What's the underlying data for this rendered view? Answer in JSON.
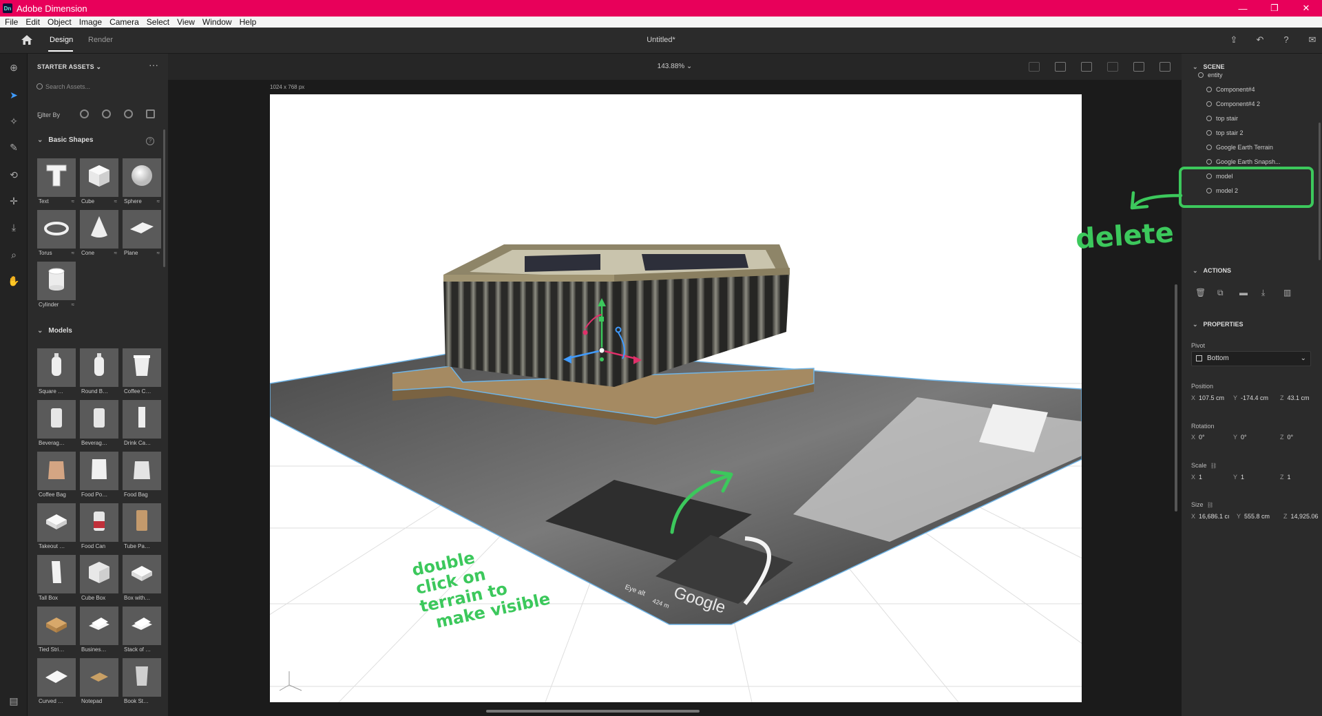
{
  "window": {
    "app_name": "Adobe Dimension",
    "logo": "Dn",
    "minimize": "—",
    "restore": "❐",
    "close": "✕"
  },
  "menu": [
    "File",
    "Edit",
    "Object",
    "Image",
    "Camera",
    "Select",
    "View",
    "Window",
    "Help"
  ],
  "topbar": {
    "tab_design": "Design",
    "tab_render": "Render",
    "doc_title": "Untitled*"
  },
  "canvas": {
    "zoom": "143.88% ⌄",
    "dimensions": "1024 x 768 px"
  },
  "assets": {
    "header": "STARTER ASSETS ⌄",
    "more": "···",
    "search_placeholder": "Search Assets...",
    "filter_label": "Filter By",
    "basic_shapes_title": "Basic Shapes",
    "basic_shapes": [
      {
        "label": "Text",
        "icon": "text-3d-icon"
      },
      {
        "label": "Cube",
        "icon": "cube-icon"
      },
      {
        "label": "Sphere",
        "icon": "sphere-icon"
      },
      {
        "label": "Torus",
        "icon": "torus-icon"
      },
      {
        "label": "Cone",
        "icon": "cone-icon"
      },
      {
        "label": "Plane",
        "icon": "plane-icon"
      },
      {
        "label": "Cylinder",
        "icon": "cylinder-icon"
      }
    ],
    "models_title": "Models",
    "models": [
      {
        "label": "Square Bo..."
      },
      {
        "label": "Round Bo..."
      },
      {
        "label": "Coffee Cup"
      },
      {
        "label": "Beverage ..."
      },
      {
        "label": "Beverage ..."
      },
      {
        "label": "Drink Cart..."
      },
      {
        "label": "Coffee Bag"
      },
      {
        "label": "Food Pouch"
      },
      {
        "label": "Food Bag"
      },
      {
        "label": "Takeout Box"
      },
      {
        "label": "Food Can"
      },
      {
        "label": "Tube Pack..."
      },
      {
        "label": "Tall Box"
      },
      {
        "label": "Cube Box"
      },
      {
        "label": "Box with O..."
      },
      {
        "label": "Tied String..."
      },
      {
        "label": "Business C..."
      },
      {
        "label": "Stack of Ca..."
      },
      {
        "label": "Curved Pla..."
      },
      {
        "label": "Notepad"
      },
      {
        "label": "Book Stan..."
      }
    ]
  },
  "scene": {
    "title": "SCENE",
    "items": [
      "entity",
      "Component#4",
      "Component#4 2",
      "top stair",
      "top stair 2",
      "Google Earth Terrain",
      "Google Earth Snapsh...",
      "model",
      "model 2"
    ]
  },
  "actions": {
    "title": "ACTIONS"
  },
  "properties": {
    "title": "PROPERTIES",
    "pivot_label": "Pivot",
    "pivot_value": "Bottom",
    "position_label": "Position",
    "position": {
      "x": "107.5 cm",
      "y": "-174.4 cm",
      "z": "43.1 cm"
    },
    "rotation_label": "Rotation",
    "rotation": {
      "x": "0°",
      "y": "0°",
      "z": "0°"
    },
    "scale_label": "Scale",
    "scale": {
      "x": "1",
      "y": "1",
      "z": "1"
    },
    "size_label": "Size",
    "size": {
      "x": "16,686.1 cı",
      "y": "555.8 cm",
      "z": "14,925.06"
    }
  },
  "scene_text": {
    "brand": "Google",
    "eye_alt": "Eye alt",
    "alt_value": "424 m"
  },
  "annotations": {
    "delete": "delete",
    "instruction_lines": [
      "double",
      "click on",
      "terrain to",
      "make visible"
    ]
  },
  "colors": {
    "titlebar": "#e8005a",
    "selection": "#3f9bff",
    "annotation": "#3cc85c"
  }
}
